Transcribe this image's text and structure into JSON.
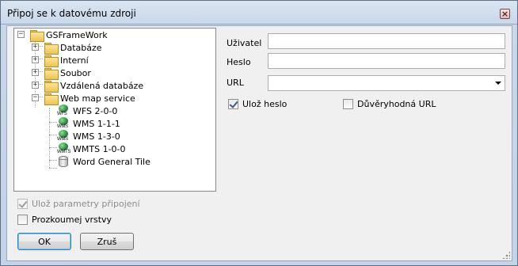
{
  "window": {
    "title": "Připoj se k datovému zdroji",
    "close_symbol": "×"
  },
  "tree": {
    "root": "GSFrameWork",
    "folders": [
      "Databáze",
      "Interní",
      "Soubor",
      "Vzdálená databáze",
      "Web map service"
    ],
    "services": [
      {
        "label": "WFS 2-0-0",
        "icon_text": "WFS"
      },
      {
        "label": "WMS 1-1-1",
        "icon_text": "WMS"
      },
      {
        "label": "WMS 1-3-0",
        "icon_text": "WMS"
      },
      {
        "label": "WMTS 1-0-0",
        "icon_text": "WMTS"
      },
      {
        "label": "Word General Tile",
        "icon_text": ""
      }
    ]
  },
  "form": {
    "user_label": "Uživatel",
    "user_value": "",
    "password_label": "Heslo",
    "password_value": "",
    "url_label": "URL",
    "url_value": "",
    "save_password_label": "Ulož heslo",
    "save_password_checked": true,
    "trusted_url_label": "Důvěryhodná URL",
    "trusted_url_checked": false
  },
  "options": {
    "save_connection_label": "Ulož parametry připojení",
    "save_connection_checked": true,
    "save_connection_disabled": true,
    "explore_layers_label": "Prozkoumej vrstvy",
    "explore_layers_checked": false
  },
  "buttons": {
    "ok_label": "OK",
    "cancel_label": "Zruš"
  },
  "icons": {
    "close": "close-icon",
    "expand": "plus-icon",
    "collapse": "minus-icon",
    "folder": "folder-icon",
    "service": "globe-icon",
    "database": "database-icon"
  }
}
